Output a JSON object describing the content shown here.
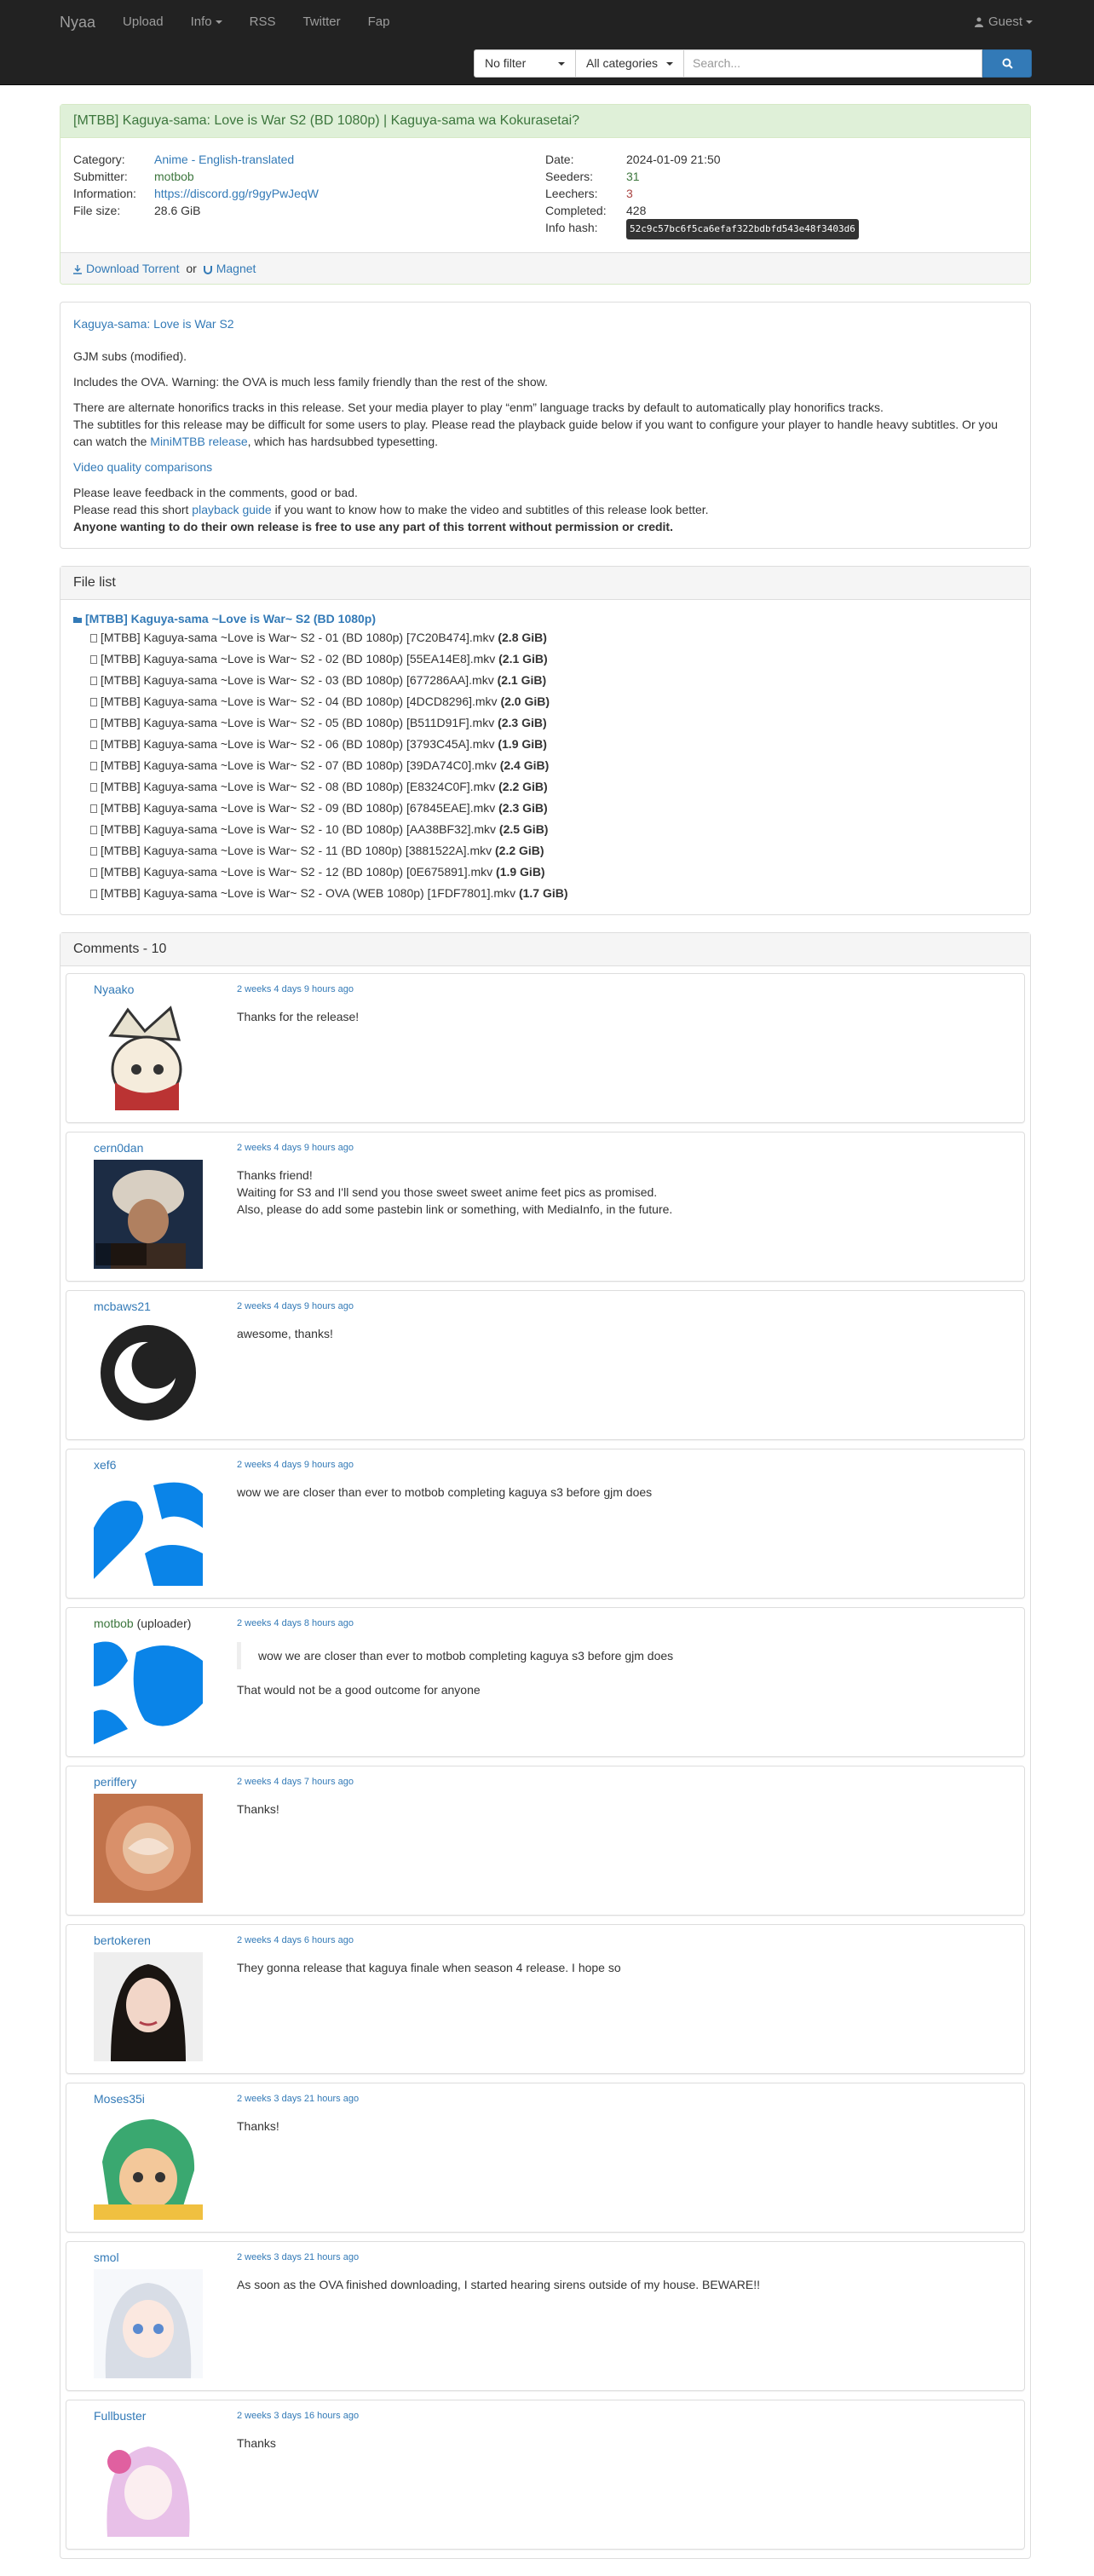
{
  "nav": {
    "brand": "Nyaa",
    "links": [
      "Upload",
      "Info",
      "RSS",
      "Twitter",
      "Fap"
    ],
    "user": "Guest"
  },
  "search": {
    "filter": "No filter",
    "category": "All categories",
    "placeholder": "Search..."
  },
  "torrent": {
    "title": "[MTBB] Kaguya-sama: Love is War S2 (BD 1080p) | Kaguya-sama wa Kokurasetai?",
    "labels": {
      "category": "Category:",
      "submitter": "Submitter:",
      "information": "Information:",
      "file_size": "File size:",
      "date": "Date:",
      "seeders": "Seeders:",
      "leechers": "Leechers:",
      "completed": "Completed:",
      "info_hash": "Info hash:"
    },
    "category": "Anime - English-translated",
    "submitter": "motbob",
    "information": "https://discord.gg/r9gyPwJeqW",
    "file_size": "28.6 GiB",
    "date": "2024-01-09 21:50",
    "seeders": "31",
    "leechers": "3",
    "completed": "428",
    "info_hash": "52c9c57bc6f5ca6efaf322bdbfd543e48f3403d6",
    "download_label": "Download Torrent",
    "or_label": "or",
    "magnet_label": "Magnet"
  },
  "description": {
    "title_link": "Kaguya-sama: Love is War S2",
    "line1": "GJM subs (modified).",
    "line2": "Includes the OVA. Warning: the OVA is much less family friendly than the rest of the show.",
    "line3": "There are alternate honorifics tracks in this release. Set your media player to play “enm” language tracks by default to automatically play honorifics tracks.",
    "line4_pre": "The subtitles for this release may be difficult for some users to play. Please read the playback guide below if you want to configure your player to handle heavy subtitles. Or you can watch the ",
    "line4_link": "MiniMTBB release",
    "line4_post": ", which has hardsubbed typesetting.",
    "video_link": "Video quality comparisons",
    "line5": "Please leave feedback in the comments, good or bad.",
    "line6_pre": "Please read this short ",
    "line6_link": "playback guide",
    "line6_post": " if you want to know how to make the video and subtitles of this release look better.",
    "line7": "Anyone wanting to do their own release is free to use any part of this torrent without permission or credit."
  },
  "file_list": {
    "heading": "File list",
    "folder": "[MTBB] Kaguya-sama ~Love is War~ S2 (BD 1080p)",
    "files": [
      {
        "name": "[MTBB] Kaguya-sama ~Love is War~ S2 - 01 (BD 1080p) [7C20B474].mkv",
        "size": "(2.8 GiB)"
      },
      {
        "name": "[MTBB] Kaguya-sama ~Love is War~ S2 - 02 (BD 1080p) [55EA14E8].mkv",
        "size": "(2.1 GiB)"
      },
      {
        "name": "[MTBB] Kaguya-sama ~Love is War~ S2 - 03 (BD 1080p) [677286AA].mkv",
        "size": "(2.1 GiB)"
      },
      {
        "name": "[MTBB] Kaguya-sama ~Love is War~ S2 - 04 (BD 1080p) [4DCD8296].mkv",
        "size": "(2.0 GiB)"
      },
      {
        "name": "[MTBB] Kaguya-sama ~Love is War~ S2 - 05 (BD 1080p) [B511D91F].mkv",
        "size": "(2.3 GiB)"
      },
      {
        "name": "[MTBB] Kaguya-sama ~Love is War~ S2 - 06 (BD 1080p) [3793C45A].mkv",
        "size": "(1.9 GiB)"
      },
      {
        "name": "[MTBB] Kaguya-sama ~Love is War~ S2 - 07 (BD 1080p) [39DA74C0].mkv",
        "size": "(2.4 GiB)"
      },
      {
        "name": "[MTBB] Kaguya-sama ~Love is War~ S2 - 08 (BD 1080p) [E8324C0F].mkv",
        "size": "(2.2 GiB)"
      },
      {
        "name": "[MTBB] Kaguya-sama ~Love is War~ S2 - 09 (BD 1080p) [67845EAE].mkv",
        "size": "(2.3 GiB)"
      },
      {
        "name": "[MTBB] Kaguya-sama ~Love is War~ S2 - 10 (BD 1080p) [AA38BF32].mkv",
        "size": "(2.5 GiB)"
      },
      {
        "name": "[MTBB] Kaguya-sama ~Love is War~ S2 - 11 (BD 1080p) [3881522A].mkv",
        "size": "(2.2 GiB)"
      },
      {
        "name": "[MTBB] Kaguya-sama ~Love is War~ S2 - 12 (BD 1080p) [0E675891].mkv",
        "size": "(1.9 GiB)"
      },
      {
        "name": "[MTBB] Kaguya-sama ~Love is War~ S2 - OVA (WEB 1080p) [1FDF7801].mkv",
        "size": "(1.7 GiB)"
      }
    ]
  },
  "comments": {
    "heading": "Comments - 10",
    "items": [
      {
        "user": "Nyaako",
        "time": "2 weeks 4 days 9 hours ago",
        "text": "Thanks for the release!"
      },
      {
        "user": "cern0dan",
        "time": "2 weeks 4 days 9 hours ago",
        "text": "Thanks friend!\nWaiting for S3 and I'll send you those sweet sweet anime feet pics as promised.\nAlso, please do add some pastebin link or something, with MediaInfo, in the future."
      },
      {
        "user": "mcbaws21",
        "time": "2 weeks 4 days 9 hours ago",
        "text": "awesome, thanks!"
      },
      {
        "user": "xef6",
        "time": "2 weeks 4 days 9 hours ago",
        "text": "wow we are closer than ever to motbob completing kaguya s3 before gjm does"
      },
      {
        "user": "motbob",
        "role": "(uploader)",
        "time": "2 weeks 4 days 8 hours ago",
        "quote": "wow we are closer than ever to motbob completing kaguya s3 before gjm does",
        "text": "That would not be a good outcome for anyone"
      },
      {
        "user": "periffery",
        "time": "2 weeks 4 days 7 hours ago",
        "text": "Thanks!"
      },
      {
        "user": "bertokeren",
        "time": "2 weeks 4 days 6 hours ago",
        "text": "They gonna release that kaguya finale when season 4 release. I hope so"
      },
      {
        "user": "Moses35i",
        "time": "2 weeks 3 days 21 hours ago",
        "text": "Thanks!"
      },
      {
        "user": "smol",
        "time": "2 weeks 3 days 21 hours ago",
        "text": "As soon as the OVA finished downloading, I started hearing sirens outside of my house. BEWARE!!"
      },
      {
        "user": "Fullbuster",
        "time": "2 weeks 3 days 16 hours ago",
        "text": "Thanks"
      }
    ]
  },
  "colors": {
    "navbar": "#222222",
    "link": "#337ab7",
    "success_bg": "#dff0d8",
    "success_text": "#3c763d",
    "danger_text": "#a94442"
  }
}
